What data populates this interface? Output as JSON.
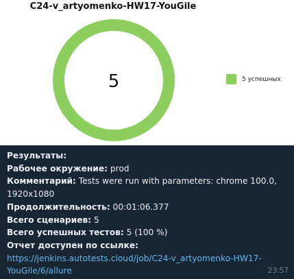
{
  "chart_data": {
    "type": "pie",
    "title": "C24-v_artyomenko-HW17-YouGile",
    "center_label": "5",
    "slices": [
      {
        "name": "5 успешных",
        "value": 5,
        "color": "#8ccf5f"
      }
    ]
  },
  "message": {
    "results_heading": "Результаты:",
    "environment_label": "Рабочее окружение:",
    "environment_value": "prod",
    "comment_label": "Комментарий:",
    "comment_value": "Tests were run with parameters: chrome 100.0, 1920x1080",
    "duration_label": "Продолжительность:",
    "duration_value": "00:01:06.377",
    "scenarios_label": "Всего сценариев:",
    "scenarios_value": "5",
    "passed_label": "Всего успешных тестов:",
    "passed_value": "5 (100 %)",
    "report_label": "Отчет доступен по ссылке:",
    "report_url": "https://jenkins.autotests.cloud/job/C24-v_artyomenko-HW17-YouGile/6/allure",
    "time": "23:57"
  },
  "colors": {
    "chat_background": "#182533",
    "link": "#62b7ee",
    "text": "#e9eef2",
    "timestamp": "#6d8293"
  }
}
